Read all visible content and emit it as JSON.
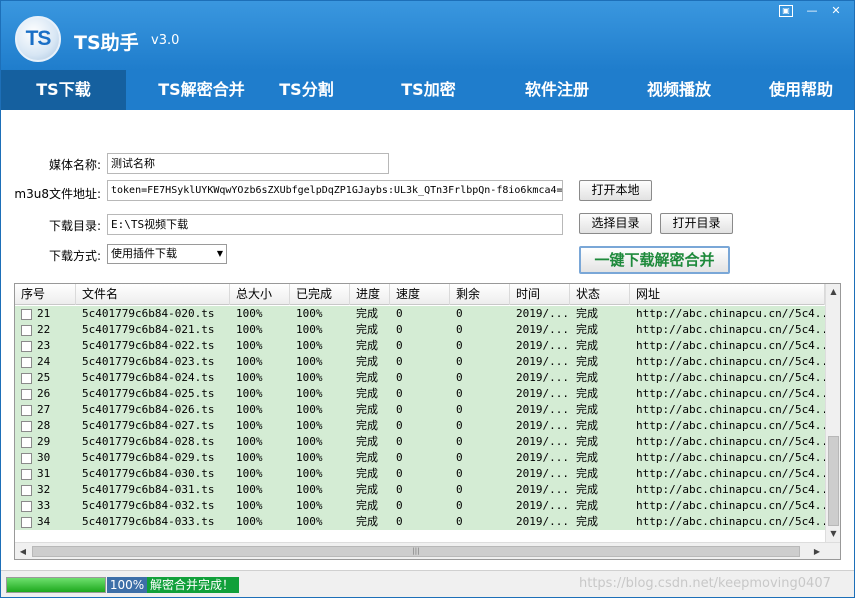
{
  "app": {
    "logo_text": "TS",
    "title": "TS助手",
    "version": "v3.0"
  },
  "window_controls": {
    "menu": "▣",
    "minimize": "—",
    "close": "✕"
  },
  "nav": {
    "tabs": [
      {
        "label": "TS下载",
        "active": true
      },
      {
        "label": "TS解密合并",
        "active": false
      },
      {
        "label": "TS分割",
        "active": false
      },
      {
        "label": "TS加密",
        "active": false
      },
      {
        "label": "软件注册",
        "active": false
      },
      {
        "label": "视频播放",
        "active": false
      },
      {
        "label": "使用帮助",
        "active": false
      }
    ]
  },
  "form": {
    "media_name_label": "媒体名称:",
    "media_name_value": "测试名称",
    "m3u8_label": "m3u8文件地址:",
    "m3u8_value": "token=FE7HSyklUYKWqwYOzb6sZXUbfgelpDqZP1GJaybs:UL3k_QTn3FrlbpQn-f8io6kmca4=",
    "open_local_button": "打开本地",
    "dir_label": "下载目录:",
    "dir_value": "E:\\TS视频下载",
    "select_dir_button": "选择目录",
    "open_dir_button": "打开目录",
    "mode_label": "下载方式:",
    "mode_value": "使用插件下载",
    "onekey_button": "一键下载解密合并"
  },
  "table": {
    "columns": [
      "序号",
      "文件名",
      "总大小",
      "已完成",
      "进度",
      "速度",
      "剩余",
      "时间",
      "状态",
      "网址"
    ],
    "rows": [
      {
        "no": "21",
        "file": "5c401779c6b84-020.ts",
        "total": "100%",
        "done": "100%",
        "progress": "完成",
        "speed": "0",
        "remain": "0",
        "time": "2019/...",
        "state": "完成",
        "url": "http://abc.chinapcu.cn//5c4..."
      },
      {
        "no": "22",
        "file": "5c401779c6b84-021.ts",
        "total": "100%",
        "done": "100%",
        "progress": "完成",
        "speed": "0",
        "remain": "0",
        "time": "2019/...",
        "state": "完成",
        "url": "http://abc.chinapcu.cn//5c4..."
      },
      {
        "no": "23",
        "file": "5c401779c6b84-022.ts",
        "total": "100%",
        "done": "100%",
        "progress": "完成",
        "speed": "0",
        "remain": "0",
        "time": "2019/...",
        "state": "完成",
        "url": "http://abc.chinapcu.cn//5c4..."
      },
      {
        "no": "24",
        "file": "5c401779c6b84-023.ts",
        "total": "100%",
        "done": "100%",
        "progress": "完成",
        "speed": "0",
        "remain": "0",
        "time": "2019/...",
        "state": "完成",
        "url": "http://abc.chinapcu.cn//5c4..."
      },
      {
        "no": "25",
        "file": "5c401779c6b84-024.ts",
        "total": "100%",
        "done": "100%",
        "progress": "完成",
        "speed": "0",
        "remain": "0",
        "time": "2019/...",
        "state": "完成",
        "url": "http://abc.chinapcu.cn//5c4..."
      },
      {
        "no": "26",
        "file": "5c401779c6b84-025.ts",
        "total": "100%",
        "done": "100%",
        "progress": "完成",
        "speed": "0",
        "remain": "0",
        "time": "2019/...",
        "state": "完成",
        "url": "http://abc.chinapcu.cn//5c4..."
      },
      {
        "no": "27",
        "file": "5c401779c6b84-026.ts",
        "total": "100%",
        "done": "100%",
        "progress": "完成",
        "speed": "0",
        "remain": "0",
        "time": "2019/...",
        "state": "完成",
        "url": "http://abc.chinapcu.cn//5c4..."
      },
      {
        "no": "28",
        "file": "5c401779c6b84-027.ts",
        "total": "100%",
        "done": "100%",
        "progress": "完成",
        "speed": "0",
        "remain": "0",
        "time": "2019/...",
        "state": "完成",
        "url": "http://abc.chinapcu.cn//5c4..."
      },
      {
        "no": "29",
        "file": "5c401779c6b84-028.ts",
        "total": "100%",
        "done": "100%",
        "progress": "完成",
        "speed": "0",
        "remain": "0",
        "time": "2019/...",
        "state": "完成",
        "url": "http://abc.chinapcu.cn//5c4..."
      },
      {
        "no": "30",
        "file": "5c401779c6b84-029.ts",
        "total": "100%",
        "done": "100%",
        "progress": "完成",
        "speed": "0",
        "remain": "0",
        "time": "2019/...",
        "state": "完成",
        "url": "http://abc.chinapcu.cn//5c4..."
      },
      {
        "no": "31",
        "file": "5c401779c6b84-030.ts",
        "total": "100%",
        "done": "100%",
        "progress": "完成",
        "speed": "0",
        "remain": "0",
        "time": "2019/...",
        "state": "完成",
        "url": "http://abc.chinapcu.cn//5c4..."
      },
      {
        "no": "32",
        "file": "5c401779c6b84-031.ts",
        "total": "100%",
        "done": "100%",
        "progress": "完成",
        "speed": "0",
        "remain": "0",
        "time": "2019/...",
        "state": "完成",
        "url": "http://abc.chinapcu.cn//5c4..."
      },
      {
        "no": "33",
        "file": "5c401779c6b84-032.ts",
        "total": "100%",
        "done": "100%",
        "progress": "完成",
        "speed": "0",
        "remain": "0",
        "time": "2019/...",
        "state": "完成",
        "url": "http://abc.chinapcu.cn//5c4..."
      },
      {
        "no": "34",
        "file": "5c401779c6b84-033.ts",
        "total": "100%",
        "done": "100%",
        "progress": "完成",
        "speed": "0",
        "remain": "0",
        "time": "2019/...",
        "state": "完成",
        "url": "http://abc.chinapcu.cn//5c4..."
      }
    ]
  },
  "scroll_icons": {
    "up": "▲",
    "down": "▼",
    "left": "◀",
    "right": "▶",
    "grip": "|||"
  },
  "status": {
    "progress_fraction": 1.0,
    "progress_text": "100%",
    "message": "解密合并完成！",
    "watermark": "https://blog.csdn.net/keepmoving0407"
  },
  "colors": {
    "title_blue": "#1f7dcc",
    "row_green": "#d4ecd4",
    "status_green": "#11a03a",
    "accent_green": "#1f8a3c"
  }
}
